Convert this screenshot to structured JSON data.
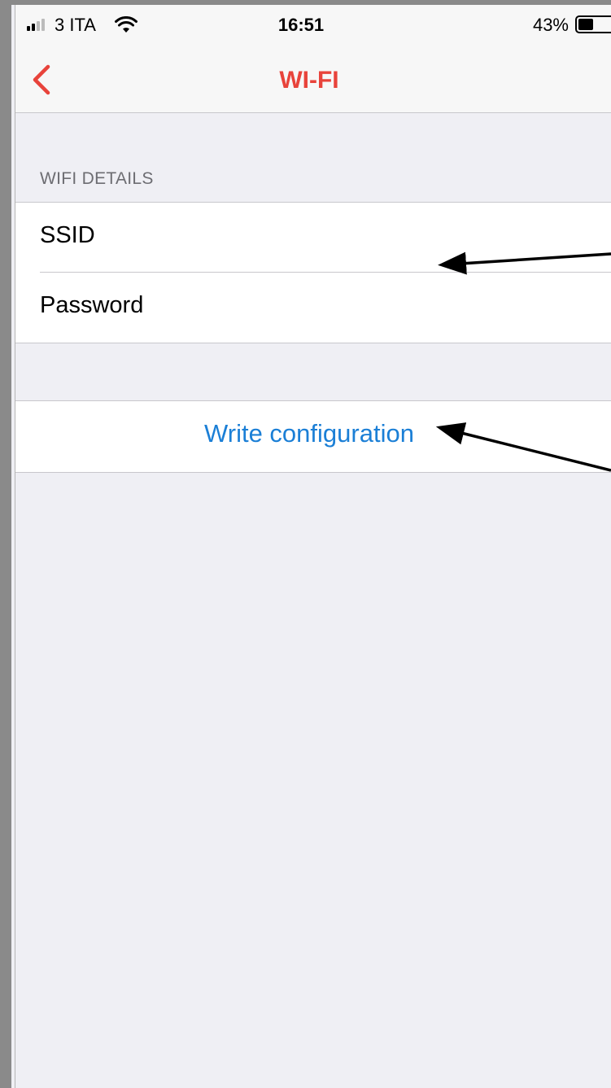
{
  "status_bar": {
    "carrier": "3 ITA",
    "time": "16:51",
    "battery_percent": "43%",
    "battery_level": 0.43,
    "signal_bars_filled": 2,
    "signal_bars_total": 4
  },
  "nav": {
    "title": "WI-FI",
    "back_icon": "chevron-left-icon"
  },
  "section": {
    "header": "WIFI DETAILS",
    "rows": [
      {
        "label": "SSID"
      },
      {
        "label": "Password"
      }
    ]
  },
  "action": {
    "label": "Write configuration"
  },
  "colors": {
    "accent_red": "#e8433b",
    "link_blue": "#1b7fd6",
    "background": "#efeff4",
    "separator": "#c8c7cc"
  }
}
